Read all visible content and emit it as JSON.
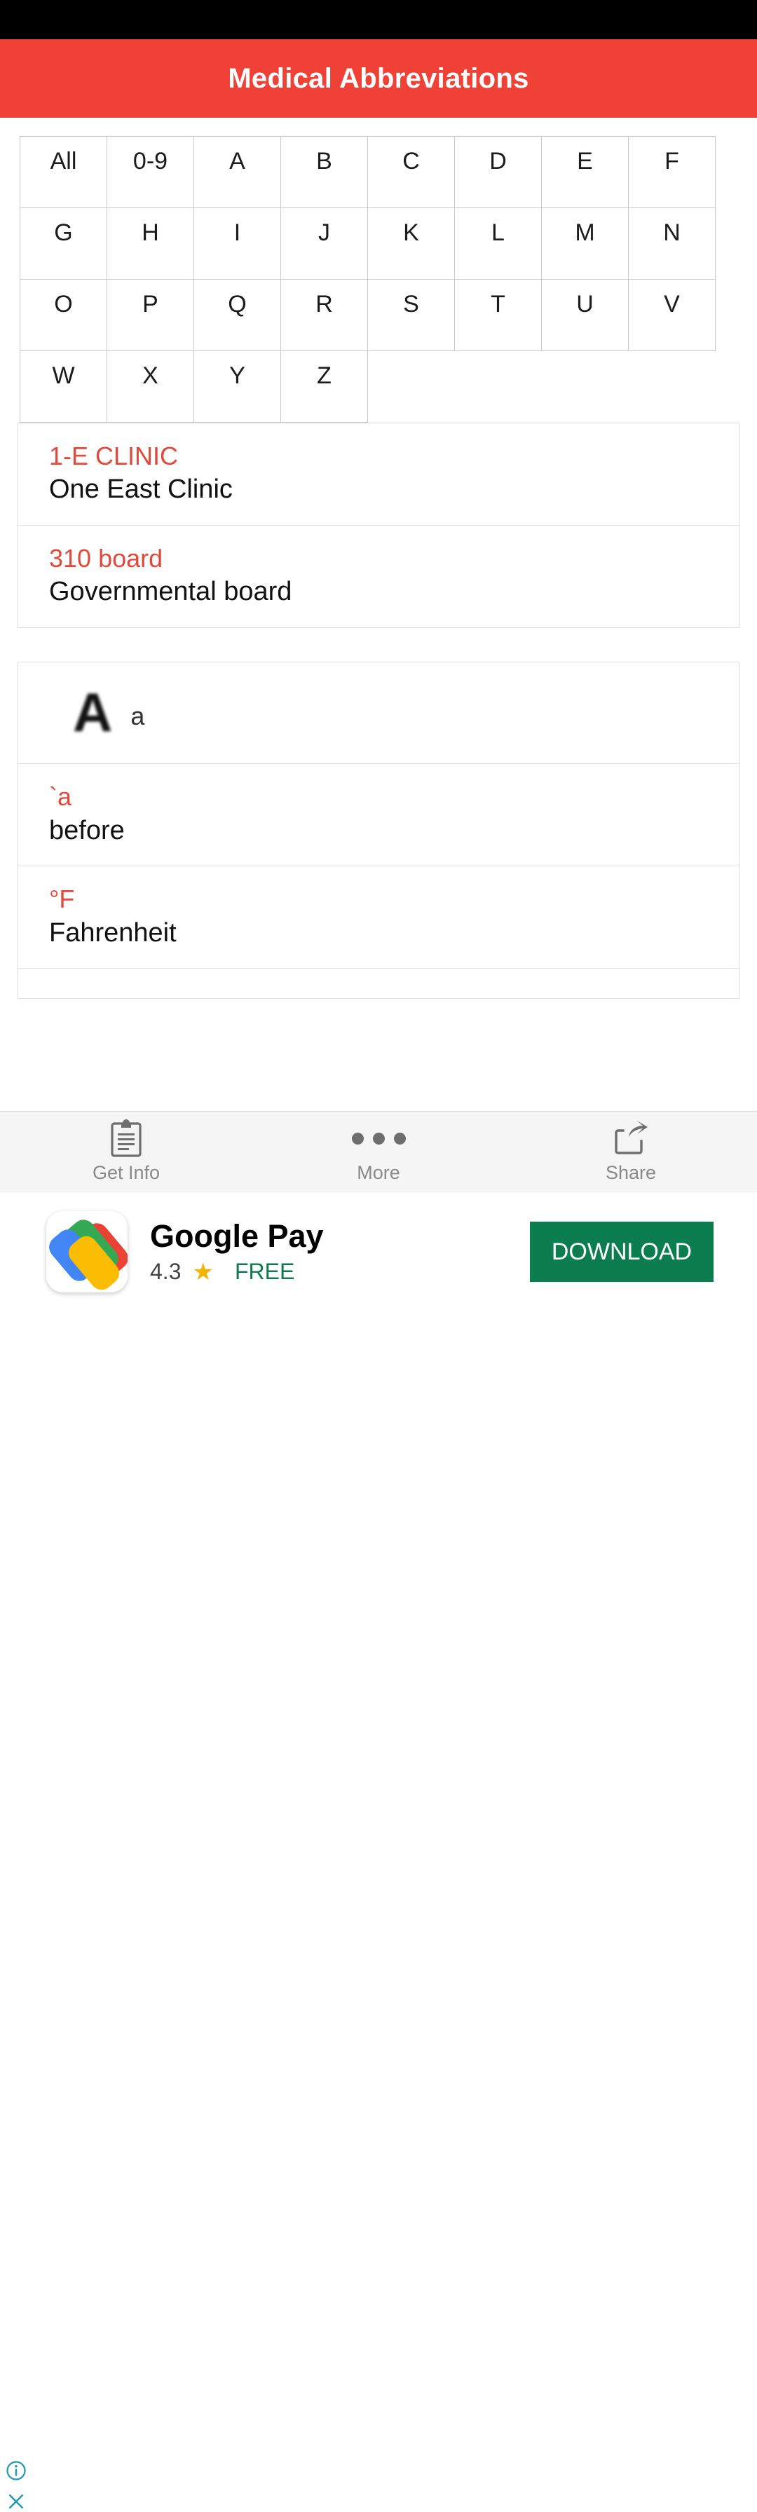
{
  "status_bar": {
    "visible": true
  },
  "header": {
    "title": "Medical Abbreviations",
    "background_color": "#ef4136",
    "text_color": "#ffffff"
  },
  "alphabet_filter": {
    "rows": [
      [
        "All",
        "0-9",
        "A",
        "B",
        "C",
        "D",
        "E",
        "F"
      ],
      [
        "G",
        "H",
        "I",
        "J",
        "K",
        "L",
        "M",
        "N"
      ],
      [
        "O",
        "P",
        "Q",
        "R",
        "S",
        "T",
        "U",
        "V"
      ],
      [
        "W",
        "X",
        "Y",
        "Z"
      ]
    ]
  },
  "list": {
    "accent_color": "#e04a3c",
    "groups": [
      {
        "entries": [
          {
            "type": "entry",
            "abbr": "1-E CLINIC",
            "meaning": "One East Clinic"
          },
          {
            "type": "entry",
            "abbr": "310 board",
            "meaning": "Governmental board"
          }
        ]
      },
      {
        "entries": [
          {
            "type": "section",
            "big_letter": "A",
            "small_letter": "a"
          },
          {
            "type": "entry",
            "abbr": "`a",
            "meaning": "before"
          },
          {
            "type": "entry",
            "abbr": "°F",
            "meaning": "Fahrenheit"
          },
          {
            "type": "entry",
            "abbr": "",
            "meaning": ""
          }
        ]
      }
    ]
  },
  "toolbar": {
    "items": [
      {
        "icon": "clipboard-icon",
        "label": "Get Info"
      },
      {
        "icon": "ellipsis-icon",
        "label": "More"
      },
      {
        "icon": "share-icon",
        "label": "Share"
      }
    ]
  },
  "ad": {
    "app_name": "Google Pay",
    "rating": "4.3",
    "star_glyph": "★",
    "price_label": "FREE",
    "cta_label": "DOWNLOAD",
    "cta_color": "#0b7d4f",
    "info_glyph": "ⓘ",
    "close_glyph": "✕",
    "control_color": "#1f9bb5"
  }
}
